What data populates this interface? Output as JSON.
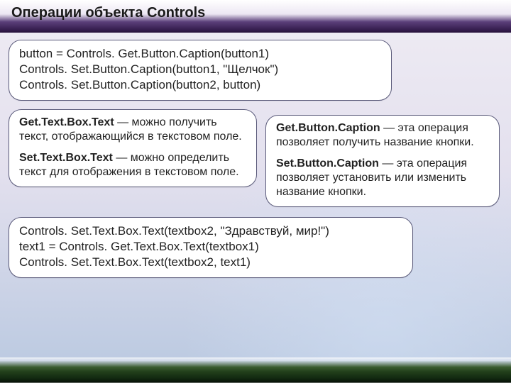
{
  "header": {
    "title": "Операции объекта Controls"
  },
  "top": {
    "line1": "button = Controls. Get.Button.Caption(button1)",
    "line2": "Controls. Set.Button.Caption(button1, \"Щелчок\")",
    "line3": "Controls. Set.Button.Caption(button2, button)"
  },
  "left": {
    "p1_bold": "Get.Text.Box.Text",
    "p1_rest": " — можно получить текст, отображающийся в текстовом поле.",
    "p2_bold": "Set.Text.Box.Text",
    "p2_rest": " — можно определить текст для отображения в текстовом поле."
  },
  "right": {
    "p1_bold": "Get.Button.Caption",
    "p1_rest": " — эта операция позволяет получить название кнопки.",
    "p2_bold": "Set.Button.Caption",
    "p2_rest": " — эта операция позволяет установить или изменить название кнопки."
  },
  "bottom": {
    "line1": "Controls. Set.Text.Box.Text(textbox2, \"Здравствуй, мир!\")",
    "line2": "text1 = Controls. Get.Text.Box.Text(textbox1)",
    "line3": "Controls. Set.Text.Box.Text(textbox2, text1)"
  }
}
